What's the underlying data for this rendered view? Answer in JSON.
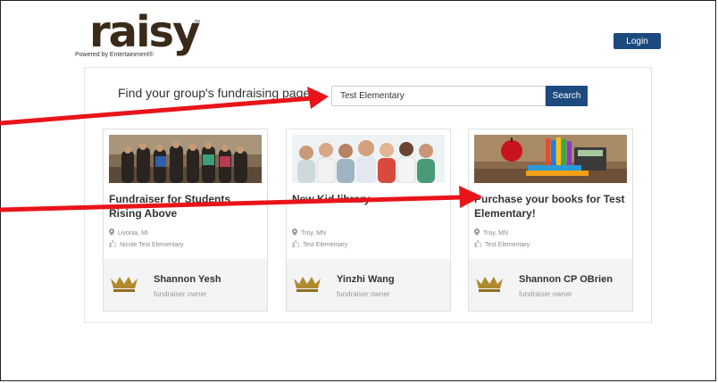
{
  "logo": {
    "text": "raisy",
    "tm": "™",
    "tagline": "Powered by Entertainment®"
  },
  "header": {
    "login_label": "Login"
  },
  "search": {
    "label": "Find your group's fundraising page:",
    "value": "Test Elementary",
    "button_label": "Search"
  },
  "cards": [
    {
      "title": "Fundraiser for Students Rising Above",
      "location": "Livonia, MI",
      "school": "Nicole Test Elementary",
      "owner_name": "Shannon Yesh",
      "owner_role": "fundraiser owner"
    },
    {
      "title": "New Kid library",
      "location": "Troy, MN",
      "school": "Test Elementary",
      "owner_name": "Yinzhi Wang",
      "owner_role": "fundraiser owner"
    },
    {
      "title": "Purchase your books for Test Elementary!",
      "location": "Troy, MN",
      "school": "Test Elementary",
      "owner_name": "Shannon CP OBrien",
      "owner_role": "fundraiser owner"
    }
  ],
  "colors": {
    "brand_blue": "#1d4a7e",
    "arrow_red": "#e8141a",
    "crown_gold": "#b08a2e"
  }
}
